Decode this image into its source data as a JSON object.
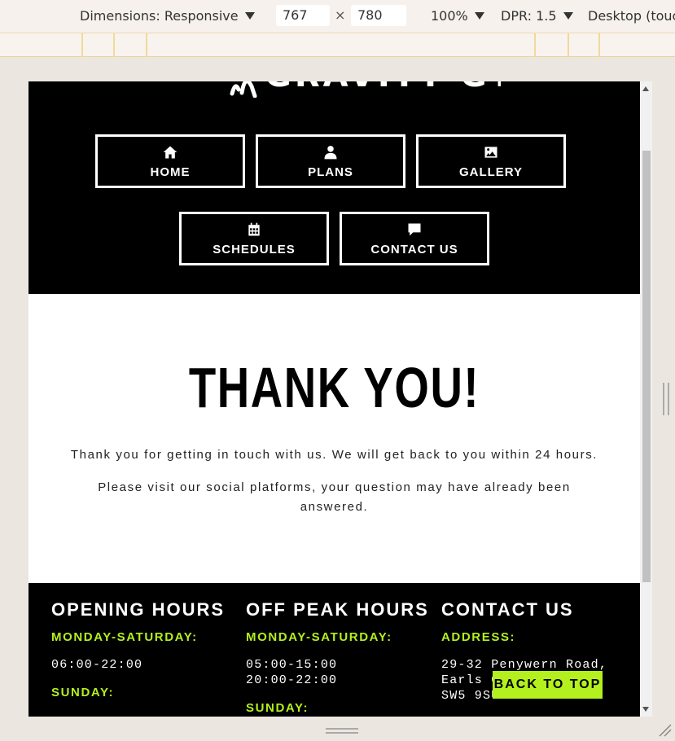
{
  "devtools": {
    "dimensions_label": "Dimensions: Responsive",
    "width_value": "767",
    "height_value": "780",
    "times": "×",
    "zoom": "100%",
    "dpr": "DPR: 1.5",
    "device_mode": "Desktop (touc"
  },
  "header": {
    "logo_text": "GRAVITY GYM",
    "nav": [
      {
        "label": "HOME",
        "icon": "home-icon"
      },
      {
        "label": "PLANS",
        "icon": "user-icon"
      },
      {
        "label": "GALLERY",
        "icon": "image-icon"
      },
      {
        "label": "SCHEDULES",
        "icon": "calendar-icon"
      },
      {
        "label": "CONTACT US",
        "icon": "comment-icon"
      }
    ]
  },
  "main": {
    "title": "THANK YOU!",
    "paragraph1": "Thank you for getting in touch with us. We will get back to you within 24 hours.",
    "paragraph2": "Please visit our social platforms, your question may have already been answered."
  },
  "footer": {
    "opening": {
      "title": "OPENING HOURS",
      "sub1": "MONDAY-SATURDAY:",
      "hours1": "06:00-22:00",
      "sub2": "SUNDAY:"
    },
    "offpeak": {
      "title": "OFF PEAK HOURS",
      "sub1": "MONDAY-SATURDAY:",
      "hours1a": "05:00-15:00",
      "hours1b": "20:00-22:00",
      "sub2": "SUNDAY:"
    },
    "contact": {
      "title": "CONTACT US",
      "sub1": "ADDRESS:",
      "addr1": "29-32 Penywern Road,",
      "addr2": "Earls Court,",
      "addr3": "SW5 9SU"
    },
    "back_to_top": "BACK TO TOP"
  },
  "colors": {
    "accent": "#b4f01e",
    "header_bg": "#000000",
    "body_bg": "#ffffff"
  }
}
